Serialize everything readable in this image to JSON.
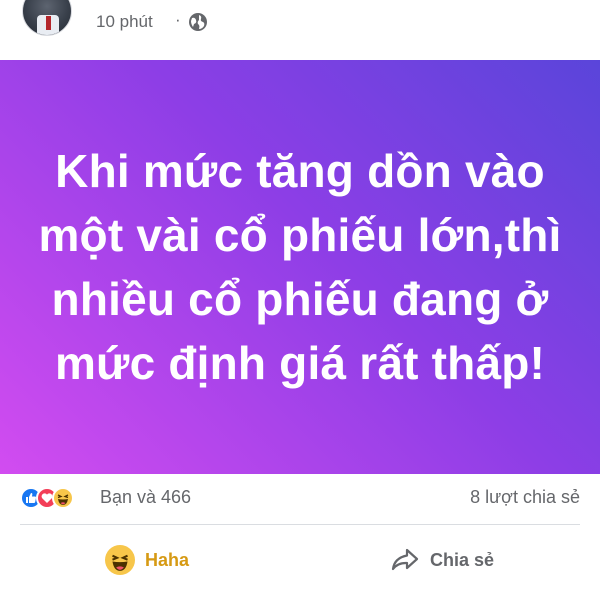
{
  "post": {
    "time": "10 phút",
    "separator": "·",
    "privacy_icon": "globe-icon",
    "text": "Khi mức tăng dồn vào một vài cổ phiếu lớn,thì nhiều cổ phiếu đang ở mức định giá rất thấp!",
    "background_gradient": [
      "#5a45da",
      "#8d3ee6",
      "#d24cf0"
    ]
  },
  "stats": {
    "reaction_icons": [
      "like-icon",
      "love-icon",
      "haha-icon"
    ],
    "reactions_text": "Bạn và 466",
    "shares_text": "8 lượt chia sẻ"
  },
  "actions": {
    "haha_label": "Haha",
    "share_label": "Chia sẻ"
  },
  "colors": {
    "haha": "#d69a14",
    "like": "#1877f2",
    "love": "#f33e58",
    "muted": "#65676b"
  }
}
